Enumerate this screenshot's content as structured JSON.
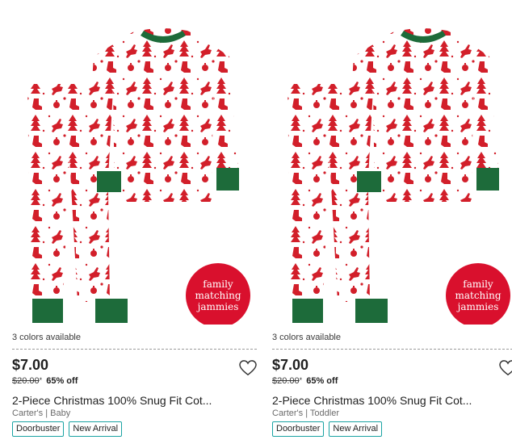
{
  "products": [
    {
      "colors_available": "3 colors available",
      "price": "$7.00",
      "original_price": "$20.00",
      "original_price_mark": "*",
      "discount": "65% off",
      "title": "2-Piece Christmas 100% Snug Fit Cot...",
      "brand_category": "Carter's | Baby",
      "badge_lines": [
        "family",
        "matching",
        "jammies"
      ],
      "tags": [
        "Doorbuster",
        "New Arrival"
      ]
    },
    {
      "colors_available": "3 colors available",
      "price": "$7.00",
      "original_price": "$20.00",
      "original_price_mark": "*",
      "discount": "65% off",
      "title": "2-Piece Christmas 100% Snug Fit Cot...",
      "brand_category": "Carter's | Toddler",
      "badge_lines": [
        "family",
        "matching",
        "jammies"
      ],
      "tags": [
        "Doorbuster",
        "New Arrival"
      ]
    }
  ],
  "icons": {
    "favorite": "heart-outline-icon"
  },
  "colors": {
    "promo_red": "#d9102d",
    "print_red": "#d21f2a",
    "cuff_green": "#1d6b3a",
    "tag_border": "#1aa3a3"
  }
}
